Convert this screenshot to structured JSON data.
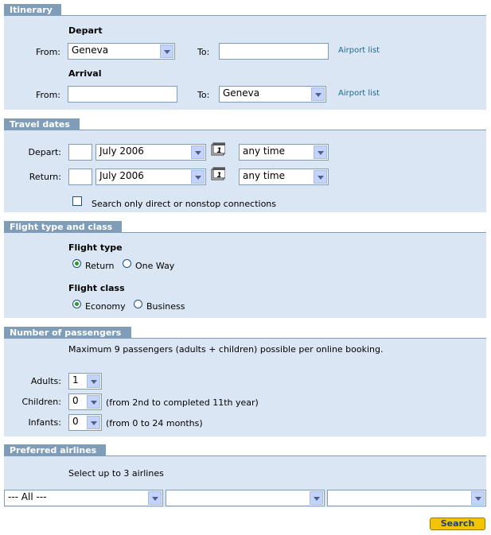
{
  "itinerary": {
    "title": "Itinerary",
    "depart_heading": "Depart",
    "arrival_heading": "Arrival",
    "from_label": "From:",
    "to_label": "To:",
    "depart_from_value": "Geneva",
    "depart_to_value": "",
    "arrival_from_value": "",
    "arrival_to_value": "Geneva",
    "airport_list_link": "Airport list"
  },
  "travel_dates": {
    "title": "Travel dates",
    "depart_label": "Depart:",
    "return_label": "Return:",
    "depart_day": "",
    "depart_month": "July 2006",
    "depart_time": "any time",
    "return_day": "",
    "return_month": "July 2006",
    "return_time": "any time",
    "direct_only_label": "Search only direct or nonstop connections",
    "calendar_glyph": "1"
  },
  "flight": {
    "title": "Flight type and class",
    "type_heading": "Flight type",
    "type_return": "Return",
    "type_oneway": "One Way",
    "class_heading": "Flight class",
    "class_economy": "Economy",
    "class_business": "Business"
  },
  "passengers": {
    "title": "Number of passengers",
    "note": "Maximum 9 passengers (adults + children) possible per online booking.",
    "adults_label": "Adults:",
    "adults_value": "1",
    "children_label": "Children:",
    "children_value": "0",
    "children_hint": "(from 2nd to completed 11th year)",
    "infants_label": "Infants:",
    "infants_value": "0",
    "infants_hint": "(from 0 to 24 months)"
  },
  "airlines": {
    "title": "Preferred airlines",
    "note": "Select up to 3 airlines",
    "airline1": "--- All ---",
    "airline2": "",
    "airline3": ""
  },
  "actions": {
    "search_label": "Search"
  },
  "colors": {
    "panel": "#dbe6f4",
    "tab": "#7f9db9",
    "search_button": "#f5c400"
  }
}
